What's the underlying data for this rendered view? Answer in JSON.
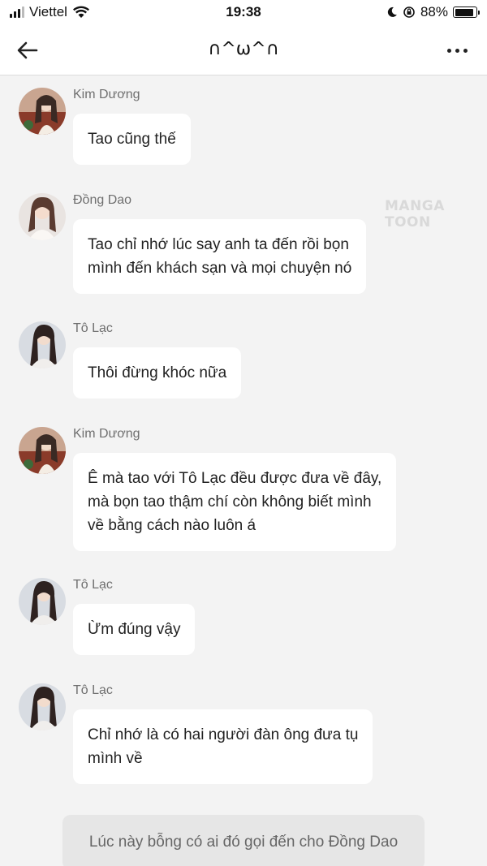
{
  "status_bar": {
    "carrier": "Viettel",
    "time": "19:38",
    "battery_text": "88%",
    "battery_level": 0.88
  },
  "header": {
    "title": "∩^ω^∩"
  },
  "watermark": "MANGA TOON",
  "messages": [
    {
      "sender": "Kim Dương",
      "text": "Tao cũng thế"
    },
    {
      "sender": "Đồng Dao",
      "text": "Tao chỉ nhớ lúc say anh ta đến rồi bọn\nmình đến khách sạn và mọi chuyện nó"
    },
    {
      "sender": "Tô Lạc",
      "text": "Thôi đừng khóc nữa"
    },
    {
      "sender": "Kim Dương",
      "text": "Ê mà tao với Tô Lạc đều được đưa về đây,\nmà bọn tao thậm chí còn không biết mình\nvề bằng cách nào luôn á"
    },
    {
      "sender": "Tô Lạc",
      "text": "Ừm đúng vậy"
    },
    {
      "sender": "Tô Lạc",
      "text": "Chỉ nhớ là có hai người đàn ông đưa tụ\nmình về"
    }
  ],
  "narration": "Lúc này bỗng có ai đó gọi đến cho Đồng Dao"
}
